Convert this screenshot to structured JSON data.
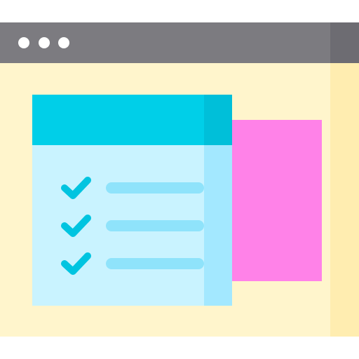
{
  "colors": {
    "titlebar": "#7c7b80",
    "titlebar_shade": "#6d6c72",
    "window_dots": "#ffffff",
    "content": "#fff5cc",
    "content_shade": "#ffedb0",
    "side_panel": "#ff82e8",
    "card_header": "#00cfe8",
    "card_header_shade": "#00bfd9",
    "card_body": "#c9f3ff",
    "card_body_shade": "#a3e8ff",
    "check": "#00c4e0",
    "line_bar": "#8fe3fb"
  },
  "window": {
    "dots": [
      "window-dot",
      "window-dot",
      "window-dot"
    ]
  },
  "checklist": {
    "items": [
      {
        "icon": "checkmark-icon",
        "checked": true
      },
      {
        "icon": "checkmark-icon",
        "checked": true
      },
      {
        "icon": "checkmark-icon",
        "checked": true
      }
    ]
  }
}
